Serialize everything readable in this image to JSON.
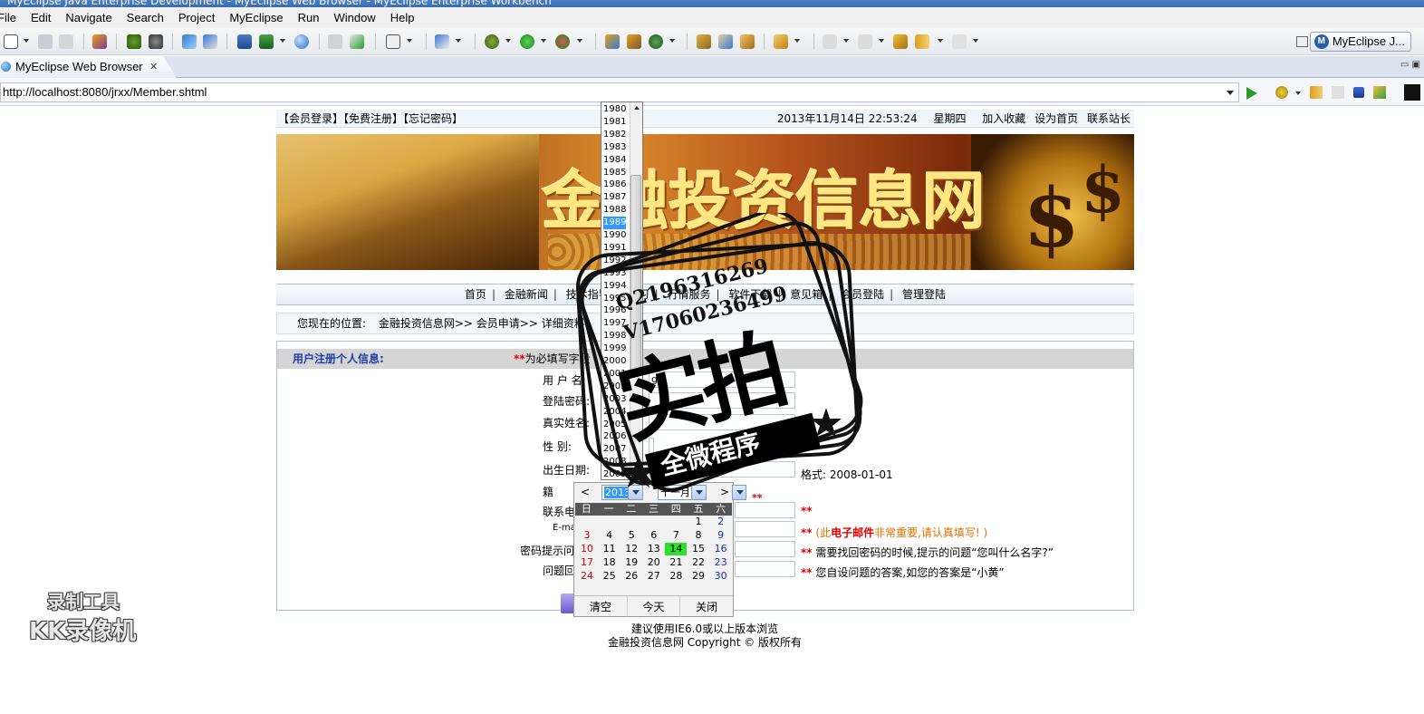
{
  "window": {
    "title": "MyEclipse Java Enterprise Development - MyEclipse Web Browser - MyEclipse Enterprise Workbench"
  },
  "menu": [
    "File",
    "Edit",
    "Navigate",
    "Search",
    "Project",
    "MyEclipse",
    "Run",
    "Window",
    "Help"
  ],
  "perspective": {
    "label": "MyEclipse J...",
    "icon": "myeclipse-perspective-icon"
  },
  "editor_tab": {
    "label": "MyEclipse Web Browser",
    "close": "✕"
  },
  "address": {
    "url": "http://localhost:8080/jrxx/Member.shtml"
  },
  "site": {
    "topbar_left": "【会员登录】【免费注册】【忘记密码】",
    "datetime": "2013年11月14日 22:53:24",
    "weekday": "星期四",
    "topbar_links": [
      "加入收藏",
      "设为首页",
      "联系站长"
    ],
    "banner_title": "金融投资信息网",
    "nav": [
      "首页",
      "金融新闻",
      "技术指导",
      "学习",
      "行情服务",
      "软件下载",
      "意见箱",
      "会员登陆",
      "管理登陆"
    ],
    "breadcrumb_label": "您现在的位置:",
    "breadcrumb": "金融投资信息网>> 会员申请>> 详细资料",
    "form_title": "用户注册个人信息:",
    "required_mark": "**",
    "required_note": "为必填写字段",
    "fields": {
      "username": {
        "label": "用 户 名:",
        "value": "g"
      },
      "password": {
        "label": "登陆密码:"
      },
      "realname": {
        "label": "真实姓名:"
      },
      "gender": {
        "label": "性    别:"
      },
      "birthdate": {
        "label": "出生日期:",
        "hint": "格式: 2008-01-01"
      },
      "native": {
        "label": "籍"
      },
      "phone": {
        "label": "联系电"
      },
      "email": {
        "label": "E-ma"
      },
      "pwd_hint_q": {
        "label": "密码提示问"
      },
      "pwd_hint_a": {
        "label": "问题回"
      }
    },
    "hints": {
      "email_pre": "(此",
      "email_em1": "电子邮件",
      "email_em2": "非常重要",
      "email_post": ",请认真填写! )",
      "question": "需要找回密码的时候,提示的问题“您叫什么名字?”",
      "answer": "您自设问题的答案,如您的答案是“小黄”"
    },
    "footer": [
      "建议使用IE6.0或以上版本浏览",
      "金融投资信息网 Copyright © 版权所有"
    ]
  },
  "year_dropdown": {
    "years": [
      "1980",
      "1981",
      "1982",
      "1983",
      "1984",
      "1985",
      "1986",
      "1987",
      "1988",
      "1989",
      "1990",
      "1991",
      "1992",
      "1993",
      "1994",
      "1995",
      "1996",
      "1997",
      "1998",
      "1999",
      "2000",
      "2001",
      "2002",
      "2003",
      "2004",
      "2005",
      "2006",
      "2007",
      "2008",
      "2009"
    ],
    "highlighted": "1989"
  },
  "calendar": {
    "prev": "<",
    "next": ">",
    "year_value": "2013",
    "month_value": "十一月",
    "weekdays": [
      "日",
      "一",
      "二",
      "三",
      "四",
      "五",
      "六"
    ],
    "weeks": [
      [
        "",
        "",
        "",
        "",
        "",
        "1",
        "2"
      ],
      [
        "3",
        "4",
        "5",
        "6",
        "7",
        "8",
        "9"
      ],
      [
        "10",
        "11",
        "12",
        "13",
        "14",
        "15",
        "16"
      ],
      [
        "17",
        "18",
        "19",
        "20",
        "21",
        "22",
        "23"
      ],
      [
        "24",
        "25",
        "26",
        "27",
        "28",
        "29",
        "30"
      ]
    ],
    "today": "14",
    "buttons": [
      "清空",
      "今天",
      "关闭"
    ]
  },
  "watermarks": {
    "qq": "Q2196316269",
    "wechat": "V17060236499",
    "main": "实拍",
    "sub": "全微程序",
    "recorder_line1": "录制工具",
    "recorder_line2": "KK录像机"
  }
}
